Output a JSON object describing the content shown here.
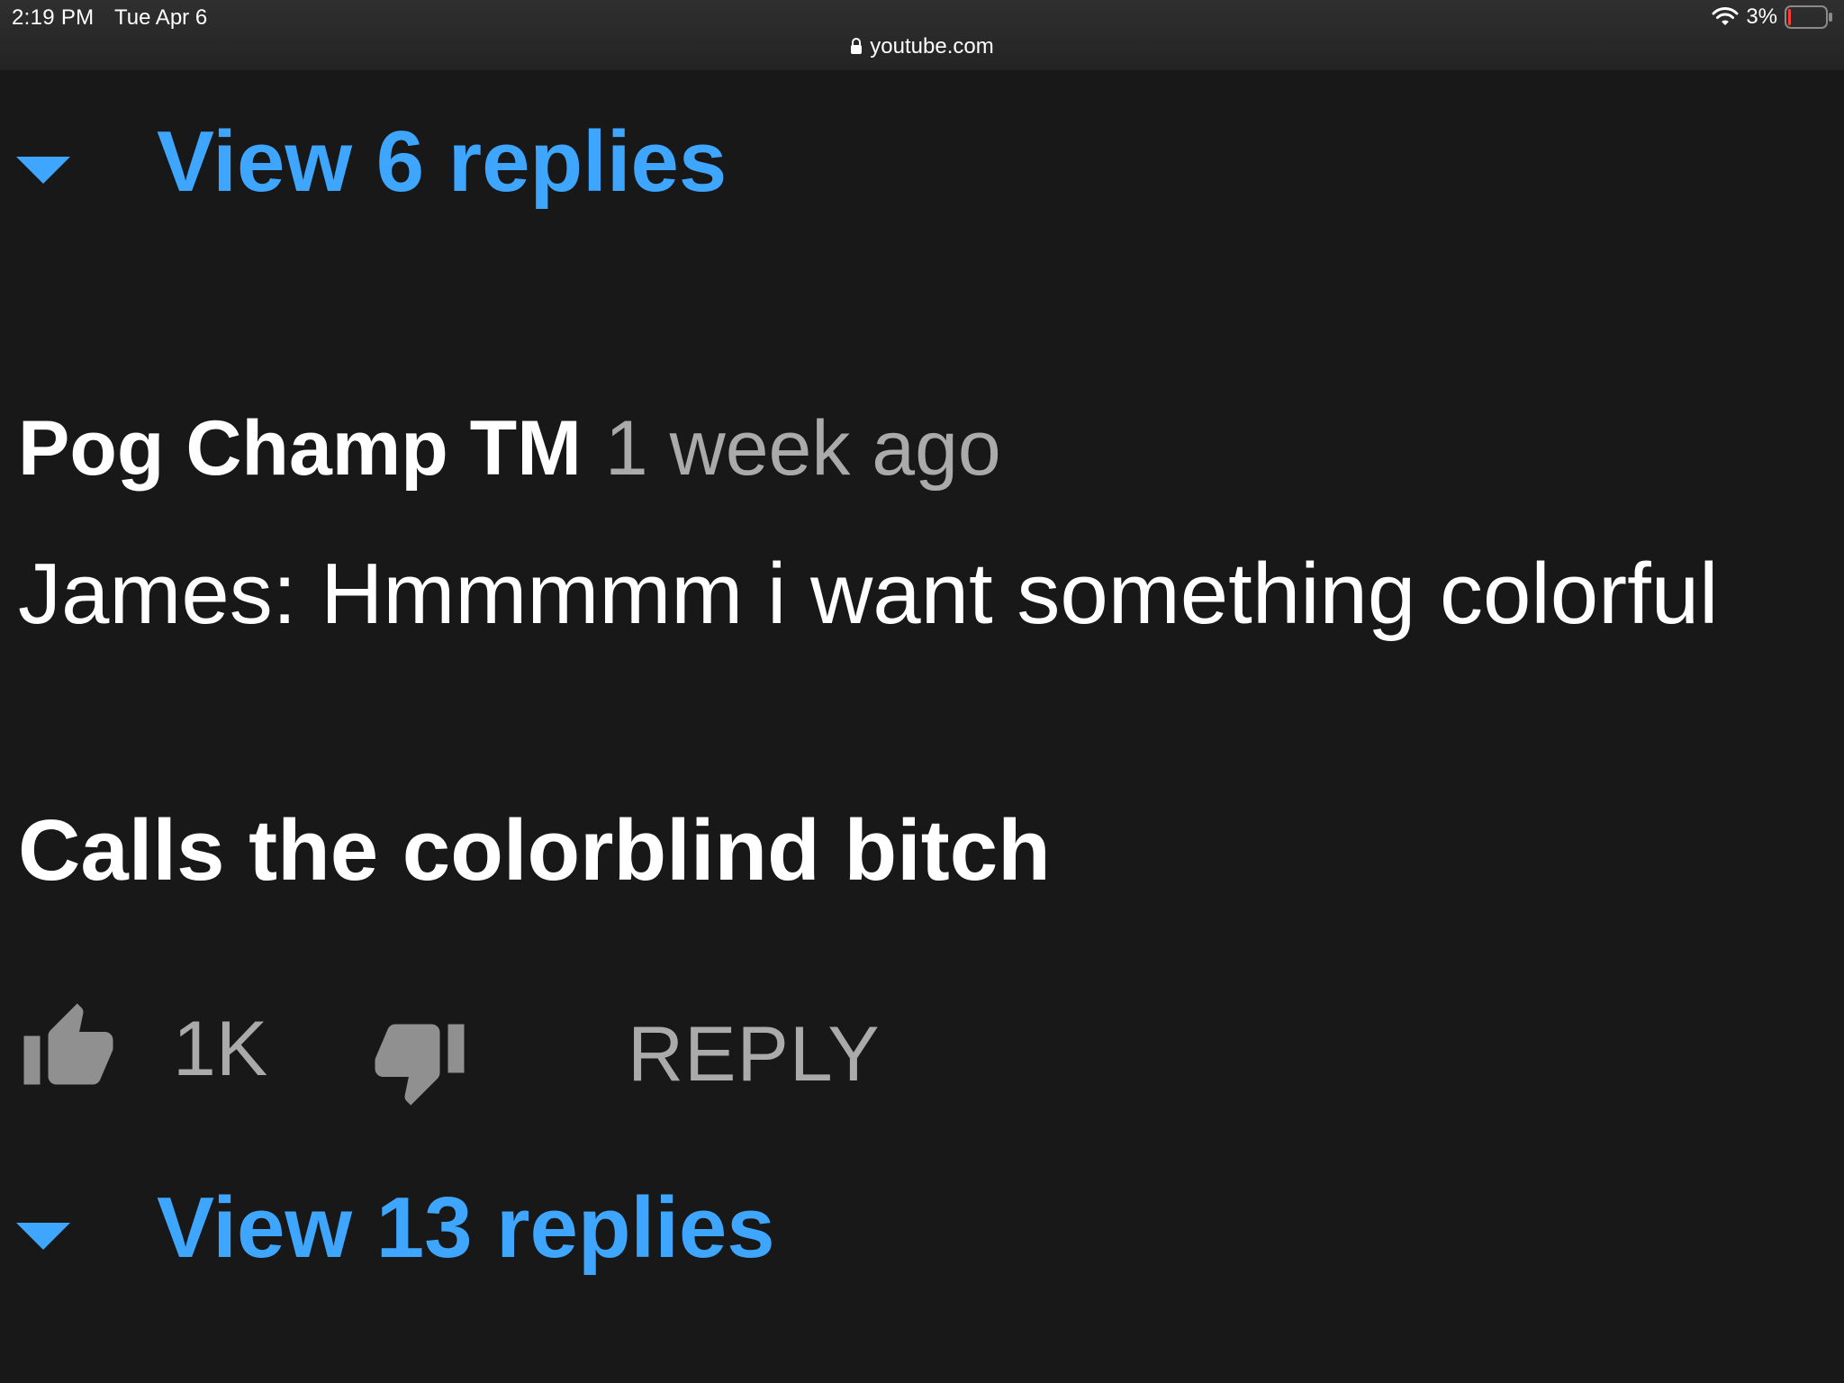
{
  "status_bar": {
    "time": "2:19 PM",
    "date": "Tue Apr 6",
    "battery_percent": "3%",
    "battery_color": "#ff3b30",
    "url": "youtube.com"
  },
  "replies_toggle_top": {
    "label": "View 6 replies",
    "icon": "caret-down-icon"
  },
  "comment": {
    "author": "Pog Champ TM",
    "time": "1 week ago",
    "text_line_1": "James: Hmmmmm i want something colorful",
    "text_line_2": "Calls the colorblind bitch",
    "like_count": "1K",
    "reply_label": "REPLY"
  },
  "replies_toggle_bottom": {
    "label": "View 13 replies",
    "icon": "caret-down-icon"
  },
  "colors": {
    "background": "#181818",
    "accent": "#3ea6ff",
    "secondary_text": "#aaaaaa"
  }
}
